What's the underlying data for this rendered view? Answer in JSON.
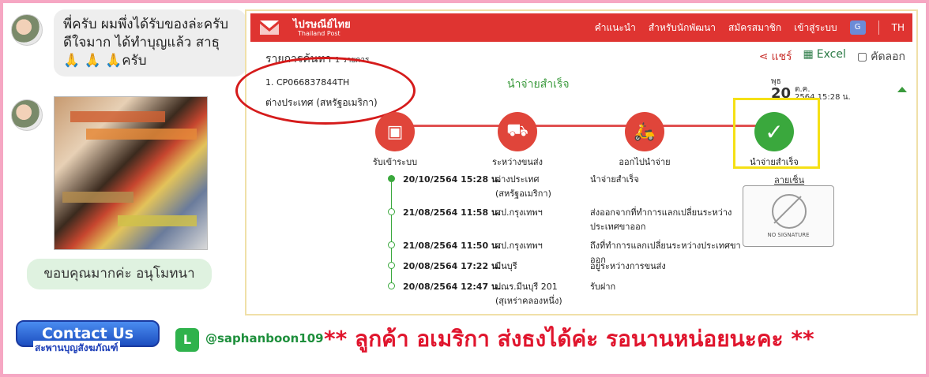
{
  "chat": {
    "message1": "พี่ครับ ผมพึ่งได้รับของล่ะครับ ดีใจมาก ได้ทำบุญแล้ว สาธุ 🙏 🙏 🙏ครับ",
    "reply": "ขอบคุณมากค่ะ อนุโมทนา"
  },
  "post": {
    "logo_th": "ไปรษณีย์ไทย",
    "logo_en": "Thailand Post",
    "nav": [
      "คำแนะนำ",
      "สำหรับนักพัฒนา",
      "สมัครสมาชิก",
      "เข้าสู่ระบบ"
    ],
    "translate_icon": "G",
    "lang": "TH",
    "results_title": "รายการค้นหา",
    "results_count": "1 รายการ",
    "tools": {
      "share": "แชร์",
      "excel": "Excel",
      "copy": "คัดลอก"
    },
    "tracking_number": "1. CP066837844TH",
    "destination": "ต่างประเทศ (สหรัฐอเมริกา)",
    "status": "นำจ่ายสำเร็จ",
    "date": {
      "weekday": "พุธ",
      "day": "20",
      "month": "ต.ค.",
      "time": "2564 15:28 น."
    },
    "steps": [
      {
        "label": "รับเข้าระบบ",
        "icon": "box-icon"
      },
      {
        "label": "ระหว่างขนส่ง",
        "icon": "truck-icon"
      },
      {
        "label": "ออกไปนำจ่าย",
        "icon": "scooter-icon"
      },
      {
        "label": "นำจ่ายสำเร็จ",
        "icon": "check-icon"
      }
    ],
    "events": [
      {
        "datetime": "20/10/2564 15:28 น.",
        "place": "ต่างประเทศ (สหรัฐอเมริกา)",
        "status": "นำจ่ายสำเร็จ"
      },
      {
        "datetime": "21/08/2564 11:58 น.",
        "place": "ศป.กรุงเทพฯ",
        "status": "ส่งออกจากที่ทำการแลกเปลี่ยนระหว่างประเทศขาออก"
      },
      {
        "datetime": "21/08/2564 11:50 น.",
        "place": "ศป.กรุงเทพฯ",
        "status": "ถึงที่ทำการแลกเปลี่ยนระหว่างประเทศขาออก"
      },
      {
        "datetime": "20/08/2564 17:22 น.",
        "place": "มีนบุรี",
        "status": "อยู่ระหว่างการขนส่ง"
      },
      {
        "datetime": "20/08/2564 12:47 น.",
        "place": "ปณร.มีนบุรี 201 (สุเหร่าคลองหนึ่ง)",
        "status": "รับฝาก"
      }
    ],
    "signature_label": "ลายเซ็น",
    "no_signature": "NO SIGNATURE"
  },
  "footer": {
    "contact": "Contact Us",
    "contact_sub": "สะพานบุญสังฆภัณฑ์",
    "line_icon": "L",
    "line_id": "@saphanboon109",
    "banner": "** ลูกค้า อเมริกา  ส่งธงได้ค่ะ  รอนานหน่อยนะคะ **"
  }
}
